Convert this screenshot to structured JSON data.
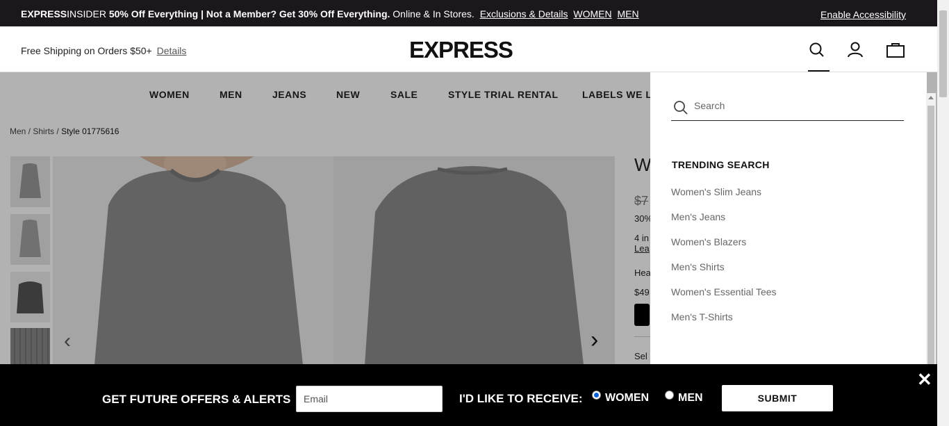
{
  "promo": {
    "brand_bold": "EXPRESS",
    "brand_rest": "INSIDER",
    "offer": "50% Off Everything | Not a Member? Get 30% Off Everything.",
    "where": "Online & In Stores.",
    "link_exclusions": "Exclusions & Details",
    "link_women": "WOMEN",
    "link_men": "MEN",
    "accessibility": "Enable Accessibility"
  },
  "header": {
    "shipping": "Free Shipping on Orders $50+",
    "shipping_link": "Details",
    "logo": "EXPRESS"
  },
  "nav": [
    "WOMEN",
    "MEN",
    "JEANS",
    "NEW",
    "SALE",
    "STYLE TRIAL RENTAL",
    "LABELS WE LO"
  ],
  "breadcrumb": {
    "men": "Men",
    "shirts": "Shirts",
    "style": "Style 01775616"
  },
  "product": {
    "title_partial": "W",
    "old_price_partial": "$7",
    "discount_partial": "30%",
    "installments_partial": "4 in",
    "learn_partial": "Lea",
    "heather_partial": "Hea",
    "price_partial": "$49",
    "select_partial": "Sel"
  },
  "search": {
    "placeholder": "Search",
    "trending_title": "TRENDING SEARCH",
    "trending": [
      "Women's Slim Jeans",
      "Men's Jeans",
      "Women's Blazers",
      "Men's Shirts",
      "Women's Essential Tees",
      "Men's T-Shirts"
    ]
  },
  "signup": {
    "label": "GET FUTURE OFFERS & ALERTS",
    "email_placeholder": "Email",
    "receive": "I'D LIKE TO RECEIVE:",
    "option_women": "WOMEN",
    "option_men": "MEN",
    "selected": "WOMEN",
    "submit": "SUBMIT",
    "close": "✕"
  },
  "colors": {
    "promo_bg": "#1b171c",
    "signup_bg": "#000000",
    "radio_selected": "#0a62d8"
  }
}
